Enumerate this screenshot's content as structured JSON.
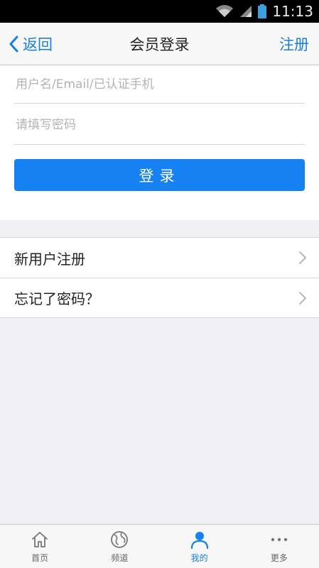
{
  "status_bar": {
    "time": "11:13"
  },
  "nav": {
    "back_label": "返回",
    "title": "会员登录",
    "register_label": "注册"
  },
  "login": {
    "username_placeholder": "用户名/Email/已认证手机",
    "password_placeholder": "请填写密码",
    "login_button": "登录"
  },
  "links": [
    {
      "label": "新用户注册"
    },
    {
      "label": "忘记了密码？"
    }
  ],
  "tabs": [
    {
      "label": "首页",
      "icon": "home-icon"
    },
    {
      "label": "频道",
      "icon": "globe-icon"
    },
    {
      "label": "我的",
      "icon": "user-icon",
      "active": true
    },
    {
      "label": "更多",
      "icon": "more-icon"
    }
  ],
  "colors": {
    "accent": "#1681f0",
    "link": "#1e7de0",
    "background": "#efeff4"
  }
}
